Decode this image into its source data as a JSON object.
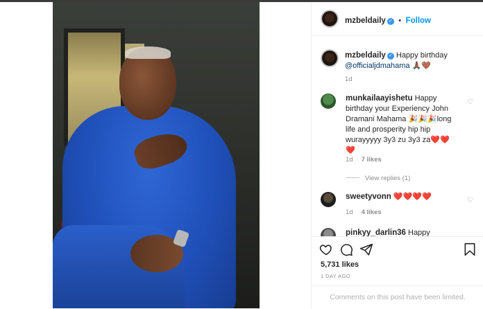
{
  "post": {
    "author": "mzbeldaily",
    "follow_label": "Follow",
    "dot": "•",
    "caption": {
      "author": "mzbeldaily",
      "text": "Happy birthday",
      "mention": "@officialjdmahama",
      "emoji": "🙏🏾🤎",
      "time": "1d"
    }
  },
  "comments": [
    {
      "user": "munkailaayishetu",
      "text": "Happy birthday your Experiency John Dramani Mahama 🎉🎉🎉long life and prosperity hip hip wurayyyyy 3y3 zu 3y3 za❤️❤️❤️",
      "time": "1d",
      "likes": "7 likes",
      "view_replies": "View replies (1)",
      "avatar_color": "#3a6b3a"
    },
    {
      "user": "sweetyvonn",
      "text": "❤️❤️❤️❤️",
      "time": "1d",
      "likes": "4 likes",
      "avatar_color": "#2b2b2b"
    },
    {
      "user": "pinkyy_darlin36",
      "text": "Happy",
      "avatar_color": "#6b6b6b"
    }
  ],
  "actions": {
    "like_icon": "heart-icon",
    "comment_icon": "comment-icon",
    "share_icon": "share-icon",
    "save_icon": "bookmark-icon",
    "likes": "5,731 likes",
    "ago": "1 day ago",
    "limited": "Comments on this post have been limited."
  },
  "colors": {
    "link": "#0095f6",
    "verified": "#3897f0",
    "muted": "#8e8e8e"
  }
}
